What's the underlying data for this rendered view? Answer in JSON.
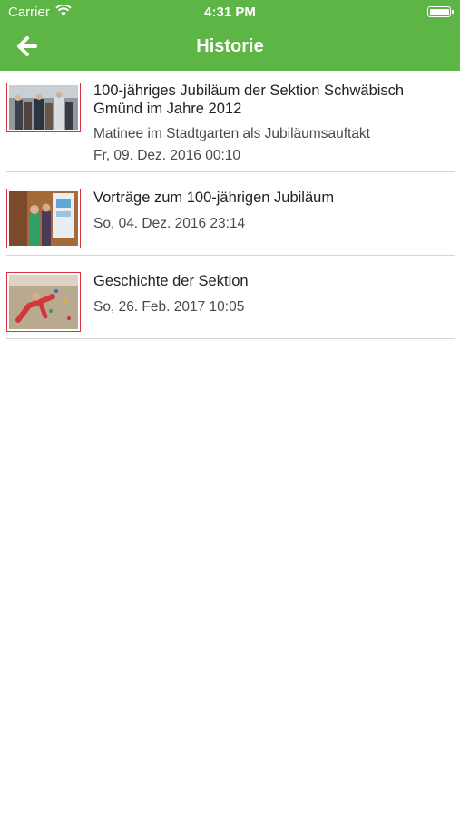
{
  "status_bar": {
    "carrier": "Carrier",
    "time": "4:31 PM"
  },
  "nav": {
    "title": "Historie",
    "back_icon": "arrow-left-icon"
  },
  "colors": {
    "brand_green": "#5cb544",
    "thumb_border": "#d9343d",
    "divider": "#d5d5d5"
  },
  "items": [
    {
      "title": "100-jähriges Jubiläum der Sektion Schwäbisch Gmünd im Jahre 2012",
      "subtitle": "Matinee im Stadtgarten als Jubiläumsauftakt",
      "date": "Fr, 09. Dez. 2016 00:10"
    },
    {
      "title": "Vorträge zum 100-jährigen Jubiläum",
      "date": "So, 04. Dez. 2016 23:14"
    },
    {
      "title": "Geschichte der Sektion",
      "date": "So, 26. Feb. 2017 10:05"
    }
  ]
}
